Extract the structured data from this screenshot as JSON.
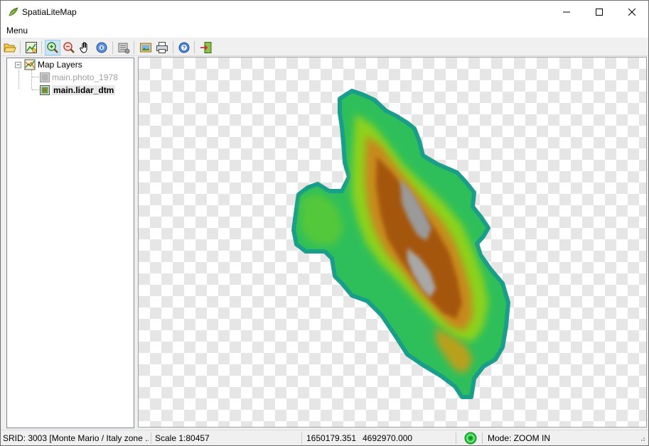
{
  "window": {
    "title": "SpatiaLiteMap"
  },
  "menubar": {
    "menu_label": "Menu"
  },
  "toolbar": {
    "buttons": [
      {
        "name": "open-icon"
      },
      {
        "name": "layer-icon"
      },
      {
        "name": "zoom-in-icon",
        "active": true
      },
      {
        "name": "zoom-out-icon"
      },
      {
        "name": "pan-hand-icon"
      },
      {
        "name": "identify-icon"
      },
      {
        "name": "settings-icon"
      },
      {
        "name": "export-image-icon"
      },
      {
        "name": "print-icon"
      },
      {
        "name": "help-icon"
      },
      {
        "name": "exit-icon"
      }
    ]
  },
  "tree": {
    "root_label": "Map Layers",
    "layers": [
      {
        "label": "main.photo_1978",
        "visible": false
      },
      {
        "label": "main.lidar_dtm",
        "visible": true,
        "selected": true
      }
    ]
  },
  "statusbar": {
    "srid": "SRID: 3003 [Monte Mario / Italy zone ...",
    "scale": "Scale 1:80457",
    "x_coord": "1650179.351",
    "y_coord": "4692970.000",
    "mode": "Mode: ZOOM IN"
  },
  "colors": {
    "elev_low": "#1fae7a",
    "elev_mid": "#3ec93a",
    "elev_high": "#b86a10",
    "elev_peak": "#b0b0b0"
  }
}
